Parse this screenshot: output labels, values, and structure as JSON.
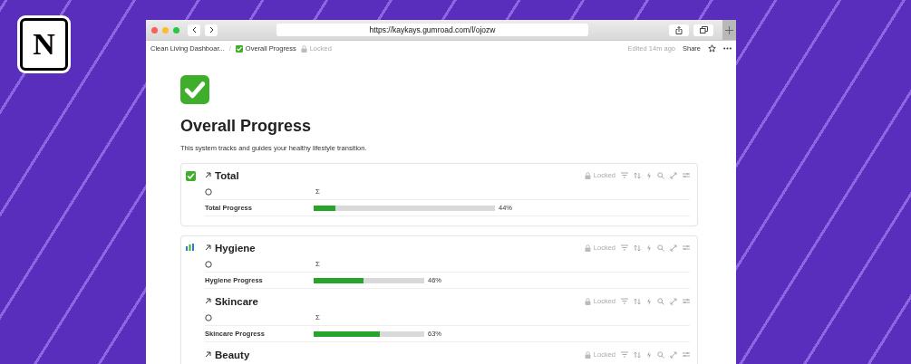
{
  "logo": {
    "letter": "N"
  },
  "browser": {
    "url": "https://kaykays.gumroad.com/l/ojozw"
  },
  "topbar": {
    "breadcrumbs": [
      {
        "label": "Clean Living Dashboar...",
        "kind": "page"
      },
      {
        "label": "Overall Progress",
        "kind": "check"
      }
    ],
    "separator": "/",
    "lock_label": "Locked",
    "edited": "Edited 14m ago",
    "share": "Share"
  },
  "page": {
    "title": "Overall Progress",
    "description": "This system tracks and guides your healthy lifestyle transition."
  },
  "sections": [
    {
      "groups": [
        {
          "title": "Total",
          "lock_label": "Locked",
          "column_label": "Σ",
          "row": {
            "name": "Total Progress",
            "level": 0.12,
            "reading": "44%"
          }
        }
      ]
    },
    {
      "groups": [
        {
          "title": "Hygiene",
          "lock_label": "Locked",
          "column_label": "Σ",
          "row": {
            "name": "Hygiene Progress",
            "level": 0.45,
            "reading": "46%"
          }
        },
        {
          "title": "Skincare",
          "lock_label": "Locked",
          "column_label": "Σ",
          "row": {
            "name": "Skincare Progress",
            "level": 0.6,
            "reading": "63%"
          }
        },
        {
          "title": "Beauty",
          "lock_label": "Locked"
        }
      ]
    }
  ]
}
